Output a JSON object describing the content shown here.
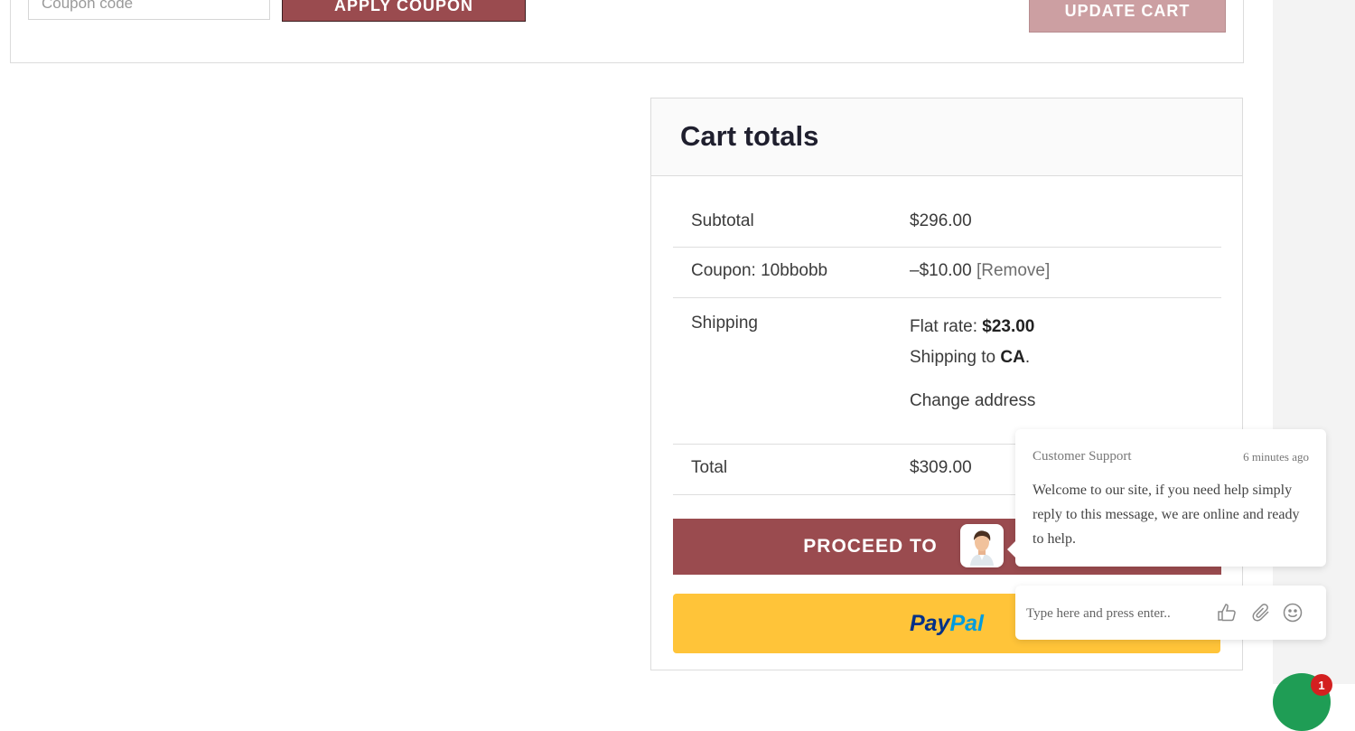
{
  "cart_actions": {
    "coupon_placeholder": "Coupon code",
    "apply_coupon_label": "APPLY COUPON",
    "update_cart_label": "UPDATE CART"
  },
  "cart_totals": {
    "title": "Cart totals",
    "subtotal": {
      "label": "Subtotal",
      "value": "$296.00"
    },
    "coupon": {
      "label": "Coupon: 10bbobb",
      "value": "–$10.00",
      "remove_label": "[Remove]"
    },
    "shipping": {
      "label": "Shipping",
      "method_label": "Flat rate:",
      "method_price": "$23.00",
      "destination_prefix": "Shipping to",
      "destination": "CA",
      "destination_suffix": ".",
      "change_address_label": "Change address"
    },
    "total": {
      "label": "Total",
      "value": "$309.00"
    },
    "proceed_label": "PROCEED TO",
    "paypal": {
      "pay": "Pay",
      "pal": "Pal"
    }
  },
  "chat": {
    "agent_name": "Customer Support",
    "time": "6 minutes ago",
    "message": "Welcome to our site, if you need help simply reply to this message, we are online and ready to help.",
    "input_placeholder": "Type here and press enter..",
    "icons": [
      "thumbs-up-icon",
      "paperclip-icon",
      "smiley-icon"
    ],
    "launcher_badge": "1"
  },
  "colors": {
    "brand": "#9a4b4f",
    "update_button": "#cc9fa2",
    "paypal": "#ffc439"
  }
}
